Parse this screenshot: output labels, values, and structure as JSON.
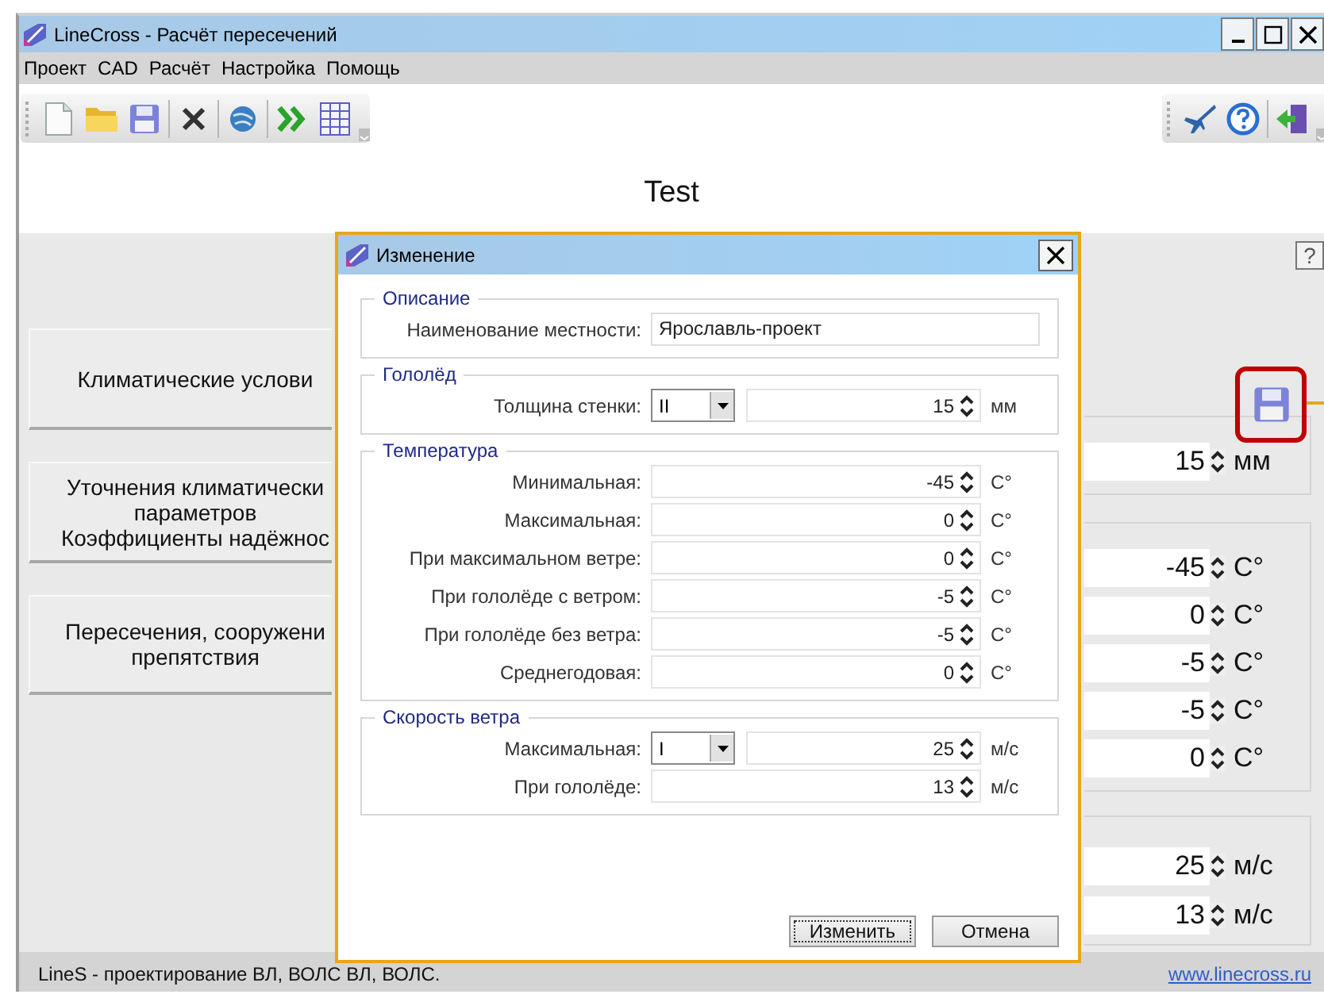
{
  "window": {
    "title": "LineCross - Расчёт пересечений"
  },
  "menu": [
    "Проект",
    "CAD",
    "Расчёт",
    "Настройка",
    "Помощь"
  ],
  "project_title": "Test",
  "sections": [
    {
      "label": "Климатические услови"
    },
    {
      "label": "Уточнения климатически\nпараметров\nКоэффициенты надёжнос"
    },
    {
      "label": "Пересечения, сооружени\nпрепятствия"
    }
  ],
  "help_button": "?",
  "background_panel": {
    "save_highlighted": true,
    "groups": [
      {
        "rows": [
          {
            "value": "15",
            "unit": "мм"
          }
        ]
      },
      {
        "rows": [
          {
            "value": "-45",
            "unit": "C°"
          },
          {
            "value": "0",
            "unit": "C°"
          },
          {
            "value": "-5",
            "unit": "C°"
          },
          {
            "value": "-5",
            "unit": "C°"
          },
          {
            "value": "0",
            "unit": "C°"
          }
        ]
      },
      {
        "rows": [
          {
            "value": "25",
            "unit": "м/с"
          },
          {
            "value": "13",
            "unit": "м/с"
          }
        ]
      }
    ]
  },
  "dialog": {
    "title": "Изменение",
    "groups": [
      {
        "title": "Описание",
        "rows": [
          {
            "kind": "text",
            "label": "Наименование местности:",
            "value": "Ярославль-проект"
          }
        ]
      },
      {
        "title": "Гололёд",
        "rows": [
          {
            "kind": "select_spin",
            "label": "Толщина стенки:",
            "select": "II",
            "value": "15",
            "unit": "мм"
          }
        ]
      },
      {
        "title": "Температура",
        "rows": [
          {
            "kind": "spin",
            "label": "Минимальная:",
            "value": "-45",
            "unit": "C°"
          },
          {
            "kind": "spin",
            "label": "Максимальная:",
            "value": "0",
            "unit": "C°"
          },
          {
            "kind": "spin",
            "label": "При максимальном ветре:",
            "value": "0",
            "unit": "C°"
          },
          {
            "kind": "spin",
            "label": "При гололёде с ветром:",
            "value": "-5",
            "unit": "C°"
          },
          {
            "kind": "spin",
            "label": "При гололёде без ветра:",
            "value": "-5",
            "unit": "C°"
          },
          {
            "kind": "spin",
            "label": "Среднегодовая:",
            "value": "0",
            "unit": "C°"
          }
        ]
      },
      {
        "title": "Скорость ветра",
        "rows": [
          {
            "kind": "select_spin",
            "label": "Максимальная:",
            "select": "I",
            "value": "25",
            "unit": "м/с"
          },
          {
            "kind": "spin",
            "label": "При гололёде:",
            "value": "13",
            "unit": "м/с"
          }
        ]
      }
    ],
    "buttons": [
      {
        "label": "Изменить",
        "focused": true
      },
      {
        "label": "Отмена",
        "focused": false
      }
    ]
  },
  "status_bar": {
    "text": "LineS - проектирование ВЛ, ВОЛС ВЛ, ВОЛС.",
    "link": "www.linecross.ru"
  }
}
